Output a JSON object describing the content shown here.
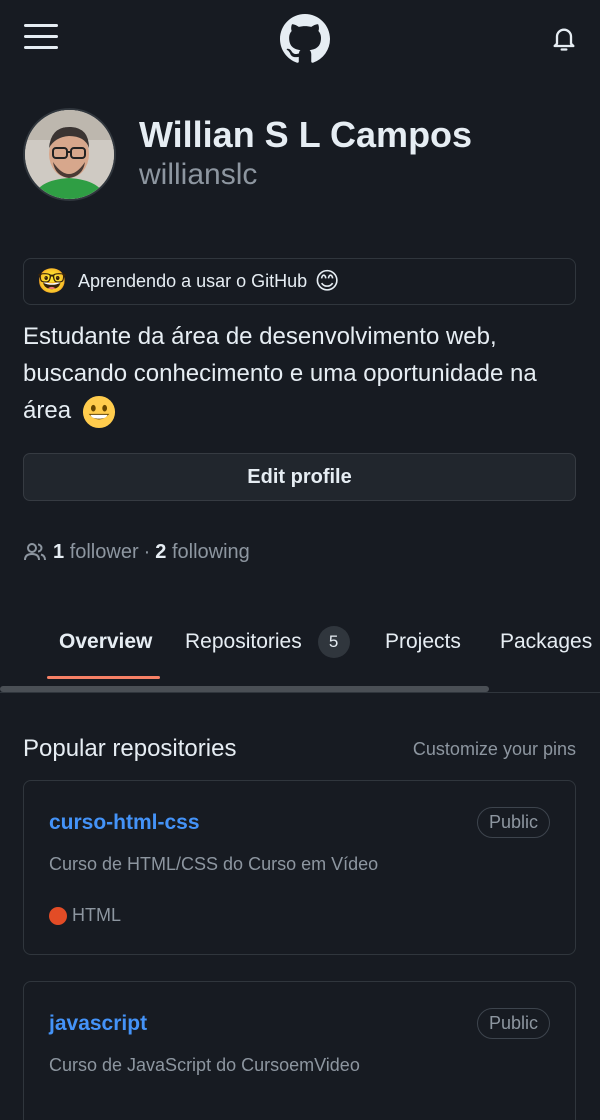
{
  "header": {
    "menu_icon": "hamburger-menu-icon",
    "logo_icon": "github-logo-icon",
    "notifications_icon": "bell-icon"
  },
  "profile": {
    "avatar": "profile-photo",
    "name": "Willian S L Campos",
    "username": "willianslc",
    "status": {
      "emoji": "🤓",
      "text": "Aprendendo a usar o GitHub",
      "trailing_emoji": "😊"
    },
    "bio": "Estudante da área de desenvolvimento web, buscando conhecimento e uma oportunidade na área",
    "bio_emoji": "grinning-face-icon",
    "edit_button": "Edit profile",
    "followers_count": "1",
    "followers_label": "follower",
    "separator": "·",
    "following_count": "2",
    "following_label": "following"
  },
  "tabs": [
    {
      "label": "Overview",
      "active": true
    },
    {
      "label": "Repositories",
      "count": "5"
    },
    {
      "label": "Projects"
    },
    {
      "label": "Packages"
    }
  ],
  "popular": {
    "title": "Popular repositories",
    "customize_link": "Customize your pins",
    "repos": [
      {
        "name": "curso-html-css",
        "visibility": "Public",
        "description": "Curso de HTML/CSS do Curso em Vídeo",
        "language": "HTML",
        "language_color": "#e34c26"
      },
      {
        "name": "javascript",
        "visibility": "Public",
        "description": "Curso de JavaScript do CursoemVideo"
      }
    ]
  },
  "colors": {
    "background": "#171b22",
    "link": "#4493f8",
    "tab_underline": "#f78166",
    "muted_text": "#8d96a0"
  }
}
